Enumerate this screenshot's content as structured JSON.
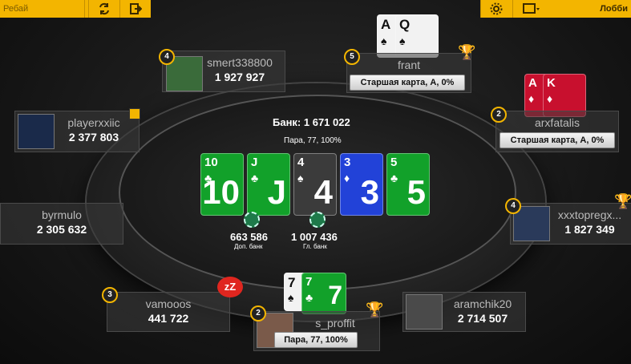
{
  "toolbar": {
    "rebuy": "Ребай",
    "lobby": "Лобби"
  },
  "pot": {
    "label": "Банк: 1 671 022",
    "hand": "Пара, 77, 100%"
  },
  "board": [
    {
      "rank": "10",
      "suit": "♣",
      "color": "green"
    },
    {
      "rank": "J",
      "suit": "♣",
      "color": "green"
    },
    {
      "rank": "4",
      "suit": "♠",
      "color": "dark"
    },
    {
      "rank": "3",
      "suit": "♦",
      "color": "blue"
    },
    {
      "rank": "5",
      "suit": "♣",
      "color": "green"
    }
  ],
  "side_pots": [
    {
      "amount": "663 586",
      "label": "Доп. банк",
      "chip": "25k"
    },
    {
      "amount": "1 007 436",
      "label": "Гл. банк",
      "chip": "25k"
    }
  ],
  "players": {
    "smert": {
      "name": "smert338800",
      "stack": "1 927 927",
      "badge": "4"
    },
    "frant": {
      "name": "frant",
      "stack": "",
      "badge": "5",
      "hand": "Старшая карта, A, 0%",
      "cards": [
        "A♠",
        "Q♠"
      ]
    },
    "playerxxiic": {
      "name": "playerxxiic",
      "stack": "2 377 803"
    },
    "arxfatalis": {
      "name": "arxfatalis",
      "stack": "",
      "badge": "2",
      "hand": "Старшая карта, A, 0%",
      "cards": [
        "A♦",
        "K♦"
      ]
    },
    "byrmulo": {
      "name": "byrmulo",
      "stack": "2 305 632"
    },
    "xxxtopregx": {
      "name": "xxxtopregx...",
      "stack": "1 827 349",
      "badge": "4"
    },
    "vamooos": {
      "name": "vamooos",
      "stack": "441 722",
      "badge": "3"
    },
    "aramchik": {
      "name": "aramchik20",
      "stack": "2 714 507"
    },
    "sproffit": {
      "name": "s_proffit",
      "stack": "",
      "badge": "2",
      "hand": "Пара, 77, 100%",
      "cards": [
        "7♠",
        "7♣"
      ]
    }
  },
  "sleep_icon": "zZ"
}
